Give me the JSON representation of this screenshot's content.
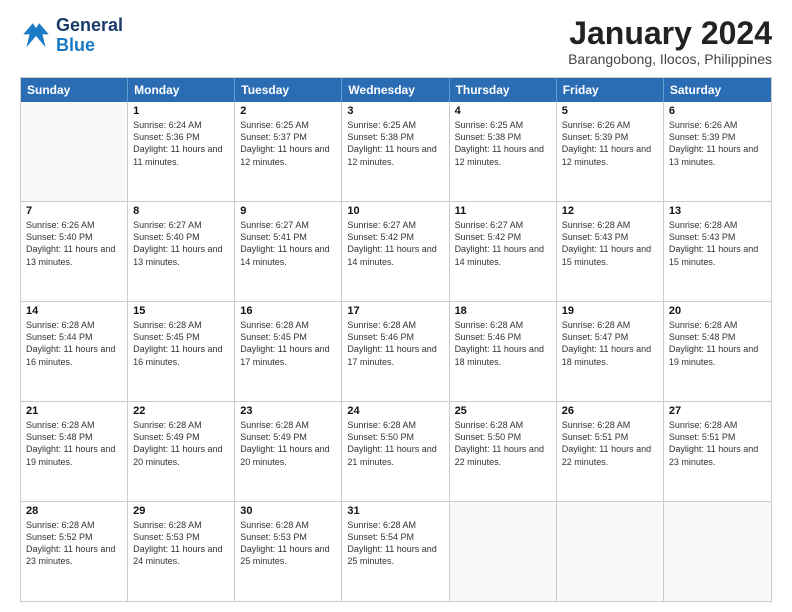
{
  "logo": {
    "line1": "General",
    "line2": "Blue"
  },
  "header": {
    "title": "January 2024",
    "subtitle": "Barangobong, Ilocos, Philippines"
  },
  "days": [
    "Sunday",
    "Monday",
    "Tuesday",
    "Wednesday",
    "Thursday",
    "Friday",
    "Saturday"
  ],
  "weeks": [
    [
      {
        "day": "",
        "empty": true
      },
      {
        "day": "1",
        "sunrise": "6:24 AM",
        "sunset": "5:36 PM",
        "daylight": "11 hours and 11 minutes."
      },
      {
        "day": "2",
        "sunrise": "6:25 AM",
        "sunset": "5:37 PM",
        "daylight": "11 hours and 12 minutes."
      },
      {
        "day": "3",
        "sunrise": "6:25 AM",
        "sunset": "5:38 PM",
        "daylight": "11 hours and 12 minutes."
      },
      {
        "day": "4",
        "sunrise": "6:25 AM",
        "sunset": "5:38 PM",
        "daylight": "11 hours and 12 minutes."
      },
      {
        "day": "5",
        "sunrise": "6:26 AM",
        "sunset": "5:39 PM",
        "daylight": "11 hours and 12 minutes."
      },
      {
        "day": "6",
        "sunrise": "6:26 AM",
        "sunset": "5:39 PM",
        "daylight": "11 hours and 13 minutes."
      }
    ],
    [
      {
        "day": "7",
        "sunrise": "6:26 AM",
        "sunset": "5:40 PM",
        "daylight": "11 hours and 13 minutes."
      },
      {
        "day": "8",
        "sunrise": "6:27 AM",
        "sunset": "5:40 PM",
        "daylight": "11 hours and 13 minutes."
      },
      {
        "day": "9",
        "sunrise": "6:27 AM",
        "sunset": "5:41 PM",
        "daylight": "11 hours and 14 minutes."
      },
      {
        "day": "10",
        "sunrise": "6:27 AM",
        "sunset": "5:42 PM",
        "daylight": "11 hours and 14 minutes."
      },
      {
        "day": "11",
        "sunrise": "6:27 AM",
        "sunset": "5:42 PM",
        "daylight": "11 hours and 14 minutes."
      },
      {
        "day": "12",
        "sunrise": "6:28 AM",
        "sunset": "5:43 PM",
        "daylight": "11 hours and 15 minutes."
      },
      {
        "day": "13",
        "sunrise": "6:28 AM",
        "sunset": "5:43 PM",
        "daylight": "11 hours and 15 minutes."
      }
    ],
    [
      {
        "day": "14",
        "sunrise": "6:28 AM",
        "sunset": "5:44 PM",
        "daylight": "11 hours and 16 minutes."
      },
      {
        "day": "15",
        "sunrise": "6:28 AM",
        "sunset": "5:45 PM",
        "daylight": "11 hours and 16 minutes."
      },
      {
        "day": "16",
        "sunrise": "6:28 AM",
        "sunset": "5:45 PM",
        "daylight": "11 hours and 17 minutes."
      },
      {
        "day": "17",
        "sunrise": "6:28 AM",
        "sunset": "5:46 PM",
        "daylight": "11 hours and 17 minutes."
      },
      {
        "day": "18",
        "sunrise": "6:28 AM",
        "sunset": "5:46 PM",
        "daylight": "11 hours and 18 minutes."
      },
      {
        "day": "19",
        "sunrise": "6:28 AM",
        "sunset": "5:47 PM",
        "daylight": "11 hours and 18 minutes."
      },
      {
        "day": "20",
        "sunrise": "6:28 AM",
        "sunset": "5:48 PM",
        "daylight": "11 hours and 19 minutes."
      }
    ],
    [
      {
        "day": "21",
        "sunrise": "6:28 AM",
        "sunset": "5:48 PM",
        "daylight": "11 hours and 19 minutes."
      },
      {
        "day": "22",
        "sunrise": "6:28 AM",
        "sunset": "5:49 PM",
        "daylight": "11 hours and 20 minutes."
      },
      {
        "day": "23",
        "sunrise": "6:28 AM",
        "sunset": "5:49 PM",
        "daylight": "11 hours and 20 minutes."
      },
      {
        "day": "24",
        "sunrise": "6:28 AM",
        "sunset": "5:50 PM",
        "daylight": "11 hours and 21 minutes."
      },
      {
        "day": "25",
        "sunrise": "6:28 AM",
        "sunset": "5:50 PM",
        "daylight": "11 hours and 22 minutes."
      },
      {
        "day": "26",
        "sunrise": "6:28 AM",
        "sunset": "5:51 PM",
        "daylight": "11 hours and 22 minutes."
      },
      {
        "day": "27",
        "sunrise": "6:28 AM",
        "sunset": "5:51 PM",
        "daylight": "11 hours and 23 minutes."
      }
    ],
    [
      {
        "day": "28",
        "sunrise": "6:28 AM",
        "sunset": "5:52 PM",
        "daylight": "11 hours and 23 minutes."
      },
      {
        "day": "29",
        "sunrise": "6:28 AM",
        "sunset": "5:53 PM",
        "daylight": "11 hours and 24 minutes."
      },
      {
        "day": "30",
        "sunrise": "6:28 AM",
        "sunset": "5:53 PM",
        "daylight": "11 hours and 25 minutes."
      },
      {
        "day": "31",
        "sunrise": "6:28 AM",
        "sunset": "5:54 PM",
        "daylight": "11 hours and 25 minutes."
      },
      {
        "day": "",
        "empty": true
      },
      {
        "day": "",
        "empty": true
      },
      {
        "day": "",
        "empty": true
      }
    ]
  ]
}
